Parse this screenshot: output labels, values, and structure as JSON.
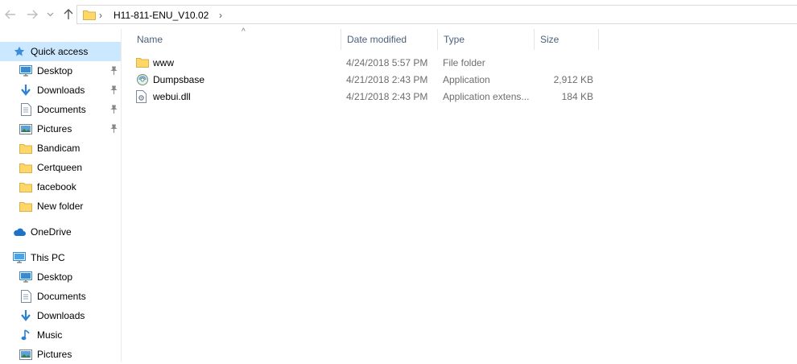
{
  "toolbar": {
    "back_icon": "arrow-left-icon",
    "forward_icon": "arrow-right-icon",
    "recent_icon": "chevron-down-icon",
    "up_icon": "arrow-up-icon"
  },
  "address": {
    "root_chevron": "›",
    "segment": "H11-811-ENU_V10.02",
    "segment_chevron": "›"
  },
  "nav": {
    "quick_access": "Quick access",
    "quick_items": [
      {
        "label": "Desktop",
        "icon": "desktop-icon",
        "pinned": true
      },
      {
        "label": "Downloads",
        "icon": "download-icon",
        "pinned": true
      },
      {
        "label": "Documents",
        "icon": "documents-icon",
        "pinned": true
      },
      {
        "label": "Pictures",
        "icon": "pictures-icon",
        "pinned": true
      },
      {
        "label": "Bandicam",
        "icon": "folder-icon",
        "pinned": false
      },
      {
        "label": "Certqueen",
        "icon": "folder-icon",
        "pinned": false
      },
      {
        "label": "facebook",
        "icon": "folder-icon",
        "pinned": false
      },
      {
        "label": "New folder",
        "icon": "folder-icon",
        "pinned": false
      }
    ],
    "onedrive": "OneDrive",
    "this_pc": "This PC",
    "pc_items": [
      {
        "label": "Desktop",
        "icon": "desktop-icon"
      },
      {
        "label": "Documents",
        "icon": "documents-icon"
      },
      {
        "label": "Downloads",
        "icon": "download-icon"
      },
      {
        "label": "Music",
        "icon": "music-icon"
      },
      {
        "label": "Pictures",
        "icon": "pictures-icon"
      }
    ]
  },
  "columns": {
    "name": "Name",
    "date": "Date modified",
    "type": "Type",
    "size": "Size",
    "sort_indicator": "^"
  },
  "files": [
    {
      "name": "www",
      "date": "4/24/2018 5:57 PM",
      "type": "File folder",
      "size": "",
      "icon": "folder-icon"
    },
    {
      "name": "Dumpsbase",
      "date": "4/21/2018 2:43 PM",
      "type": "Application",
      "size": "2,912 KB",
      "icon": "application-icon"
    },
    {
      "name": "webui.dll",
      "date": "4/21/2018 2:43 PM",
      "type": "Application extens...",
      "size": "184 KB",
      "icon": "dll-file-icon"
    }
  ],
  "colors": {
    "selection": "#cce8ff",
    "folder": "#ffd766",
    "header_text": "#4c607a",
    "meta_text": "#6d6d6d"
  }
}
